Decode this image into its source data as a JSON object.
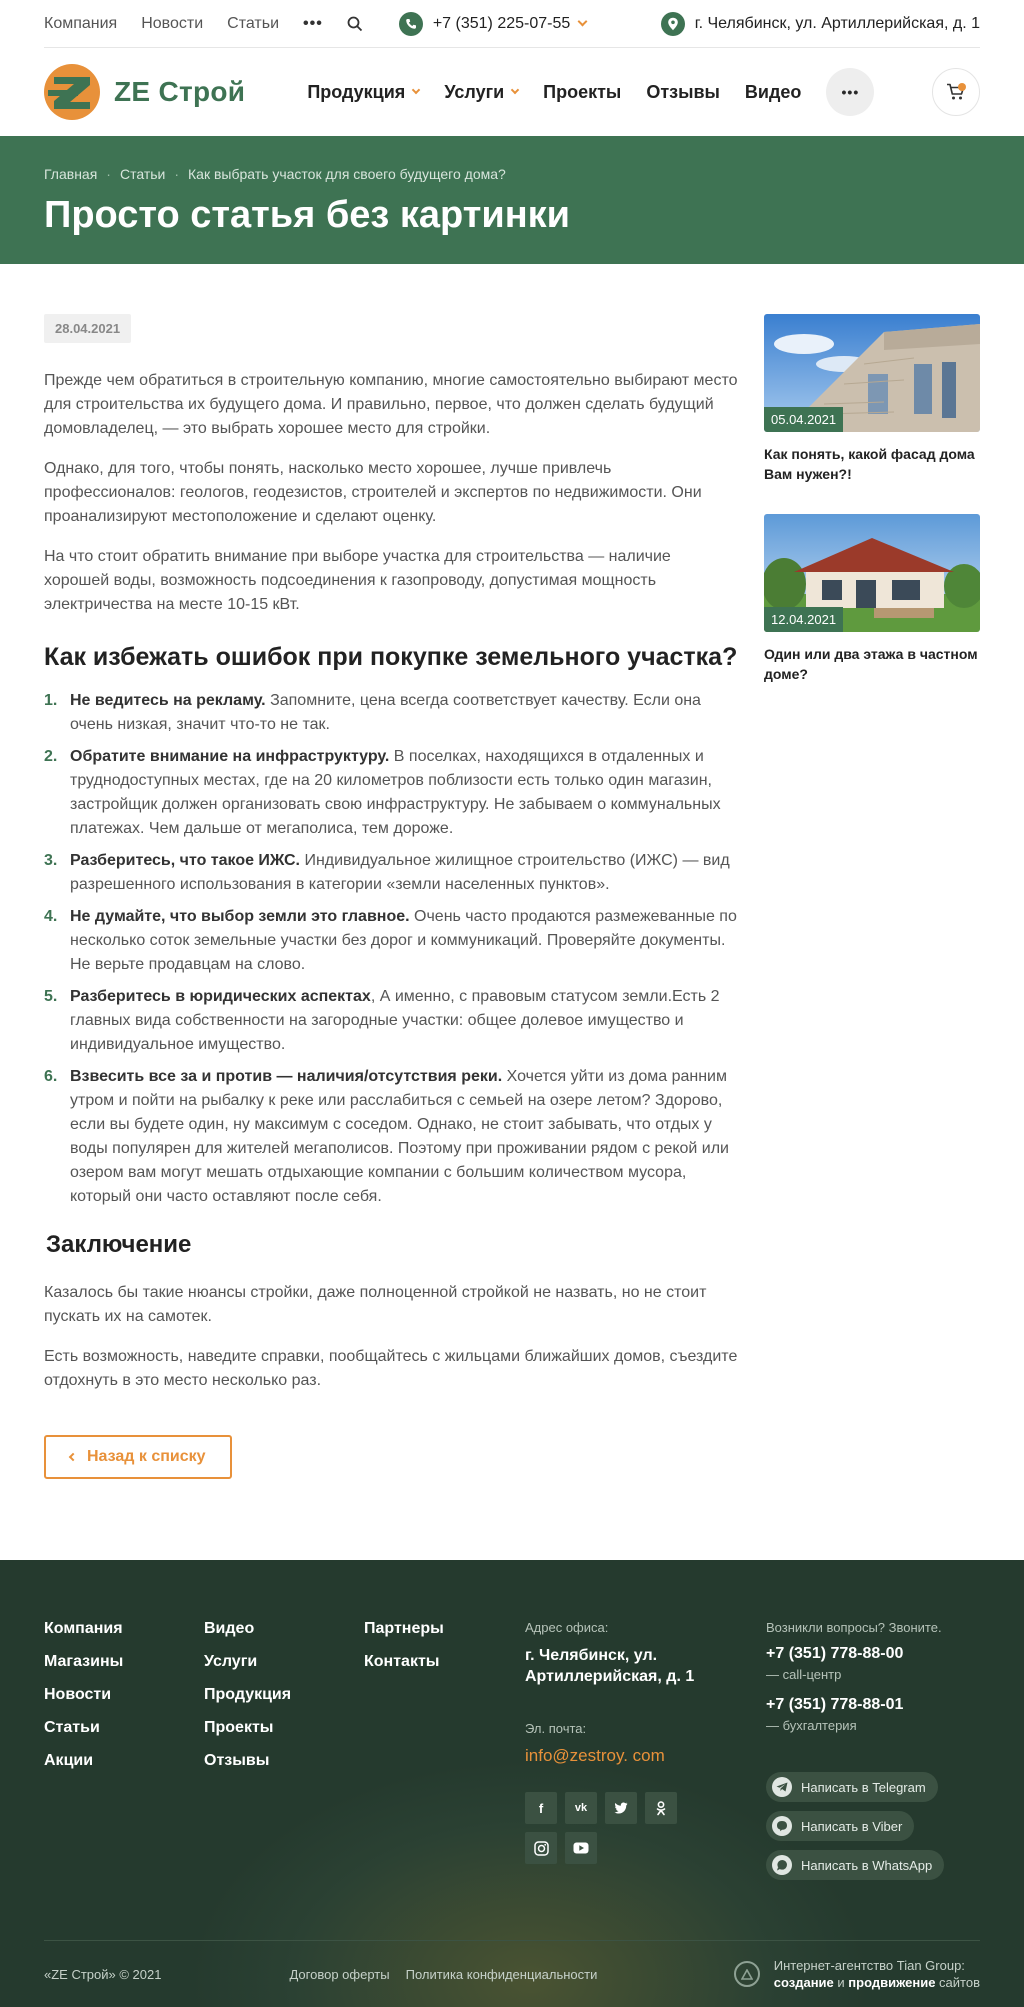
{
  "topbar": {
    "links": [
      "Компания",
      "Новости",
      "Статьи"
    ],
    "more": "•••",
    "phone": "+7 (351) 225-07-55",
    "address": "г. Челябинск, ул. Артиллерийская, д. 1"
  },
  "header": {
    "logo_text": "ZE Строй",
    "nav": [
      {
        "label": "Продукция"
      },
      {
        "label": "Услуги"
      },
      {
        "label": "Проекты"
      },
      {
        "label": "Отзывы"
      },
      {
        "label": "Видео"
      }
    ],
    "more": "•••"
  },
  "hero": {
    "breadcrumbs": [
      "Главная",
      "Статьи",
      "Как выбрать участок для своего будущего дома?"
    ],
    "title": "Просто статья без картинки"
  },
  "article": {
    "date": "28.04.2021",
    "intro": [
      "Прежде чем обратиться в строительную компанию, многие самостоятельно выбирают место для строительства их будущего дома. И правильно, первое, что должен сделать будущий домовладелец, — это выбрать хорошее место для стройки.",
      "Однако, для того, чтобы понять, насколько место хорошее, лучше привлечь профессионалов: геологов, геодезистов, строителей и экспертов по недвижимости. Они проанализируют местоположение и сделают оценку.",
      "На что стоит обратить внимание при выборе участка для строительства — наличие хорошей воды, возможность подсоединения к газопроводу, допустимая мощность электричества на месте 10-15 кВт."
    ],
    "h2": "Как избежать ошибок при покупке земельного участка?",
    "list": [
      {
        "num": "1.",
        "bold": "Не ведитесь на рекламу.",
        "text": " Запомните, цена всегда соответствует качеству. Если она очень низкая, значит что-то не так."
      },
      {
        "num": "2.",
        "bold": "Обратите внимание на инфраструктуру.",
        "text": "  В поселках, находящихся в отдаленных и труднодоступных местах, где на 20 километров поблизости есть только один магазин, застройщик должен организовать свою инфраструктуру. Не забываем о коммунальных платежах. Чем дальше от мегаполиса, тем дороже."
      },
      {
        "num": "3.",
        "bold": "Разберитесь, что такое ИЖС.",
        "text": " Индивидуальное жилищное строительство (ИЖС) — вид разрешенного использования в категории «земли населенных пунктов»."
      },
      {
        "num": "4.",
        "bold": "Не думайте, что выбор земли это главное.",
        "text": " Очень часто продаются размежеванные по несколько соток земельные участки без дорог и коммуникаций. Проверяйте документы. Не верьте продавцам на слово."
      },
      {
        "num": "5.",
        "bold": "Разберитесь в юридических аспектах",
        "text": ", А именно, с правовым статусом земли.Есть 2 главных вида собственности на загородные участки: общее долевое имущество и индивидуальное имущество."
      },
      {
        "num": "6.",
        "bold": "Взвесить все за и против — наличия/отсутствия реки.",
        "text": " Хочется уйти из дома ранним утром и пойти на рыбалку к реке или расслабиться с семьей на озере летом? Здорово, если вы будете один, ну максимум с соседом. Однако, не стоит забывать, что отдых у воды популярен для жителей мегаполисов. Поэтому при проживании рядом с рекой или озером вам могут мешать отдыхающие компании с большим количеством мусора, который они часто оставляют после себя."
      }
    ],
    "h3": "Заключение",
    "outro": [
      "Казалось бы такие нюансы стройки, даже полноценной стройкой не назвать, но не стоит пускать их на самотек.",
      "Есть возможность, наведите справки, пообщайтесь с жильцами ближайших домов, съездите отдохнуть в это место несколько раз."
    ],
    "back_label": "Назад к списку"
  },
  "sidebar": {
    "cards": [
      {
        "date": "05.04.2021",
        "title": "Как понять, какой фасад дома Вам нужен?!"
      },
      {
        "date": "12.04.2021",
        "title": "Один или два этажа в частном доме?"
      }
    ]
  },
  "footer": {
    "col1": [
      "Компания",
      "Магазины",
      "Новости",
      "Статьи",
      "Акции"
    ],
    "col2": [
      "Видео",
      "Услуги",
      "Продукция",
      "Проекты",
      "Отзывы"
    ],
    "col3": [
      "Партнеры",
      "Контакты"
    ],
    "address_label": "Адрес офиса:",
    "address": "г. Челябинск, ул. Артиллерийская, д. 1",
    "email_label": "Эл. почта:",
    "email": "info@zestroy. com",
    "social": [
      "f",
      "vk",
      "twitter",
      "ok",
      "instagram",
      "youtube"
    ],
    "questions_label": "Возникли вопросы? Звоните.",
    "phones": [
      {
        "number": "+7 (351) 778-88-00",
        "note": "— call-центр"
      },
      {
        "number": "+7 (351) 778-88-01",
        "note": "— бухгалтерия"
      }
    ],
    "messengers": [
      {
        "label": "Написать в Telegram",
        "icon": "telegram-icon"
      },
      {
        "label": "Написать в Viber",
        "icon": "viber-icon"
      },
      {
        "label": "Написать в WhatsApp",
        "icon": "whatsapp-icon"
      }
    ],
    "copyright": "«ZE Строй» © 2021",
    "offer": "Договор оферты",
    "privacy": "Политика конфиденциальности",
    "agency_line1": "Интернет-агентство Tian Group:",
    "agency_w1": "создание",
    "agency_and": " и ",
    "agency_w2": "продвижение",
    "agency_w3": " сайтов"
  },
  "colors": {
    "brand_green": "#3e7353",
    "accent_orange": "#e8913a",
    "footer_bg": "#2b4133"
  }
}
